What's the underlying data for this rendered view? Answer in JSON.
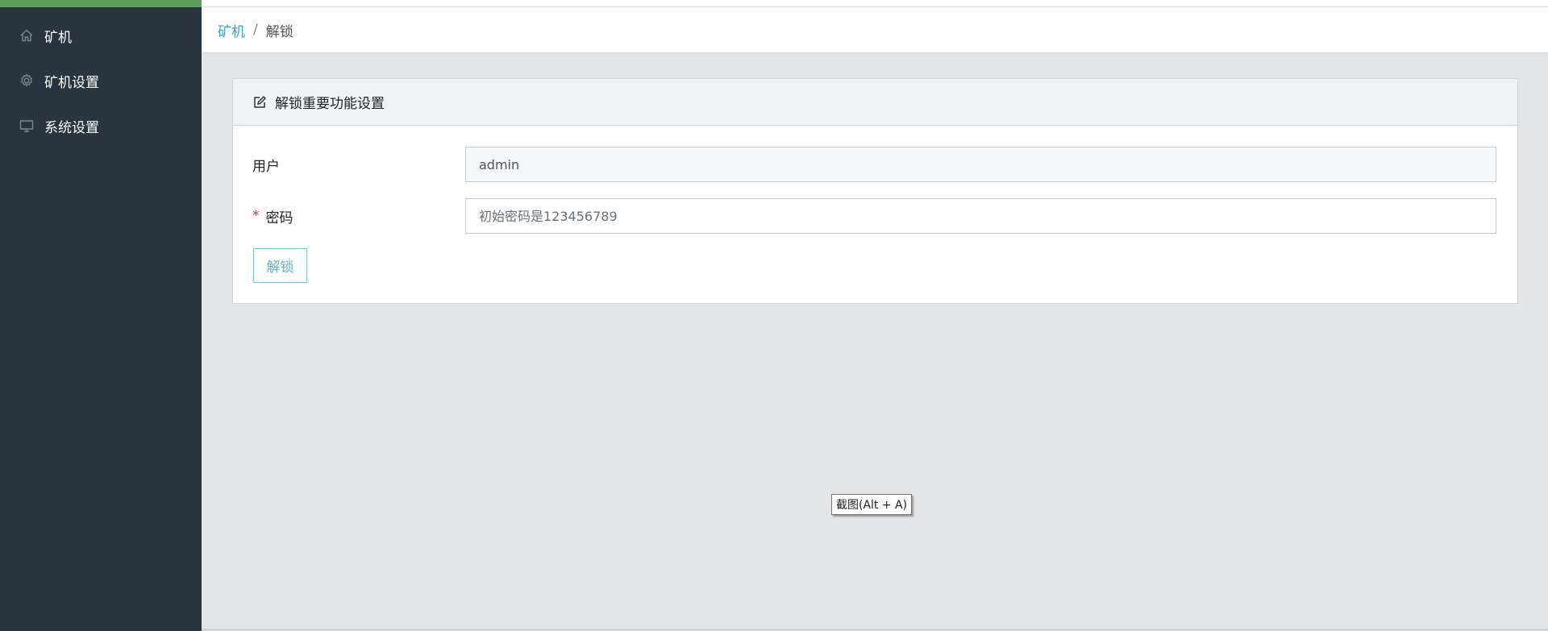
{
  "sidebar": {
    "items": [
      {
        "label": "矿机",
        "icon": "home-icon"
      },
      {
        "label": "矿机设置",
        "icon": "gear-icon"
      },
      {
        "label": "系统设置",
        "icon": "monitor-icon"
      }
    ]
  },
  "breadcrumb": {
    "parent": "矿机",
    "separator": "/",
    "current": "解锁"
  },
  "card": {
    "title": "解锁重要功能设置",
    "icon": "edit-icon",
    "user_label": "用户",
    "user_value": "admin",
    "required_mark": "*",
    "password_label": "密码",
    "password_placeholder": "初始密码是123456789",
    "unlock_button": "解锁"
  },
  "tooltip": {
    "text": "截图(Alt + A)"
  },
  "colors": {
    "sidebar_bg": "#28343e",
    "sidebar_accent": "#5e9e5c",
    "link": "#3aa3c4",
    "button_text": "#5fb3cf",
    "required": "#c0392b"
  }
}
